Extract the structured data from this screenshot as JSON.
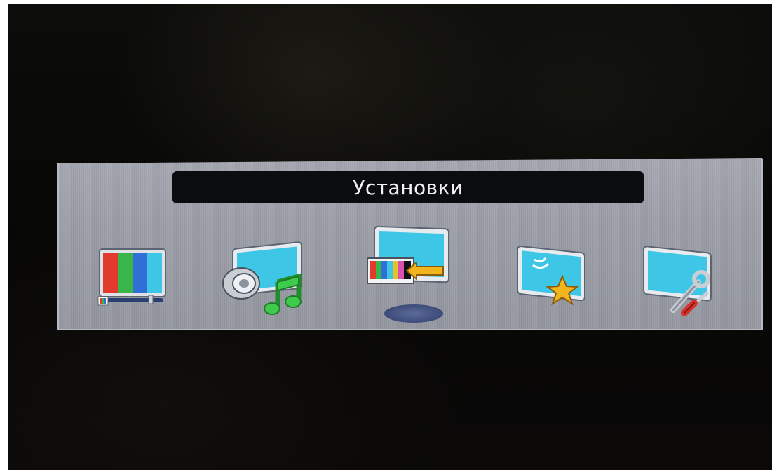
{
  "menu": {
    "title": "Установки",
    "items": [
      {
        "id": "picture",
        "icon": "color-bars-tv-icon"
      },
      {
        "id": "sound",
        "icon": "speaker-tv-icon"
      },
      {
        "id": "input",
        "icon": "input-source-tv-icon",
        "selected": true
      },
      {
        "id": "favorites",
        "icon": "star-tv-icon"
      },
      {
        "id": "settings",
        "icon": "tools-tv-icon"
      }
    ]
  },
  "colors": {
    "panel": "#9b9ea7",
    "title_bar": "#0b0c10",
    "screen_cyan": "#3ec6e6",
    "selection": "#3d4b78"
  }
}
